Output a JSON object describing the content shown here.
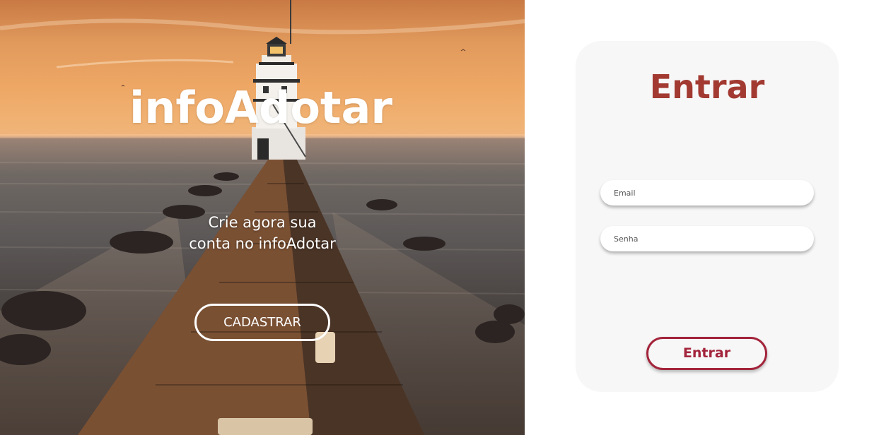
{
  "hero": {
    "brand": "infoAdotar",
    "tagline_line1": "Crie agora sua",
    "tagline_line2": "conta no infoAdotar",
    "signup_label": "CADASTRAR"
  },
  "login": {
    "title": "Entrar",
    "email_placeholder": "Email",
    "password_placeholder": "Senha",
    "submit_label": "Entrar"
  },
  "colors": {
    "accent": "#a23a32",
    "button_border": "#a3243b",
    "card_bg": "#f7f7f7",
    "hero_text": "#ffffff"
  }
}
